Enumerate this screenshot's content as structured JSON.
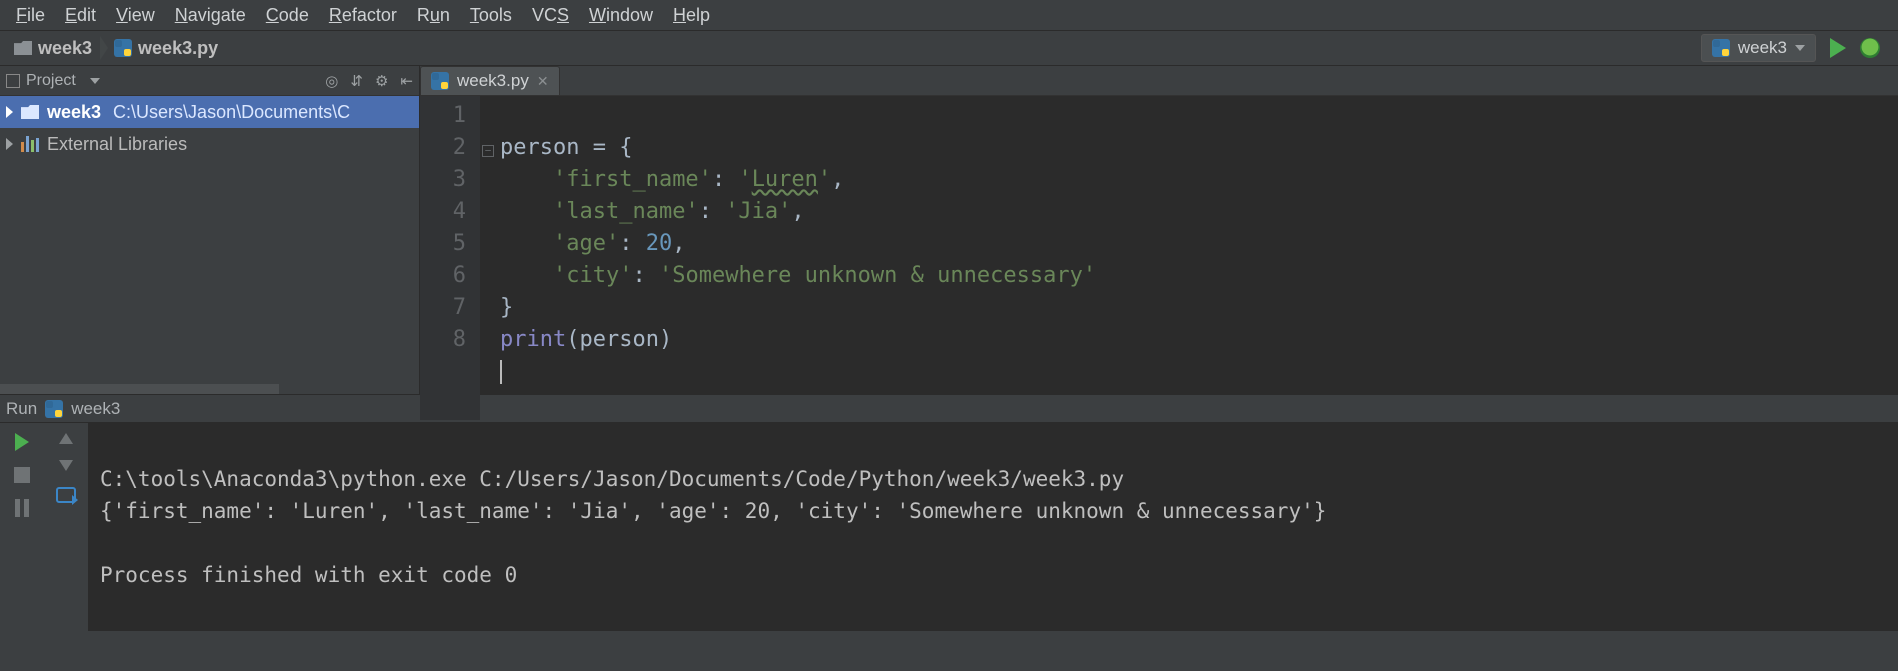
{
  "menu": {
    "items": [
      "File",
      "Edit",
      "View",
      "Navigate",
      "Code",
      "Refactor",
      "Run",
      "Tools",
      "VCS",
      "Window",
      "Help"
    ]
  },
  "breadcrumbs": {
    "project": "week3",
    "file": "week3.py"
  },
  "run_config": {
    "label": "week3"
  },
  "project_panel": {
    "title": "Project",
    "root_name": "week3",
    "root_path": "C:\\Users\\Jason\\Documents\\C",
    "ext_libs": "External Libraries"
  },
  "editor": {
    "tab": "week3.py",
    "gutter": [
      "1",
      "2",
      "3",
      "4",
      "5",
      "6",
      "7",
      "8"
    ],
    "code": {
      "l1_ident": "person",
      "l1_op": " = {",
      "l2_key": "'first_name'",
      "l2_val": "Luren",
      "l3_key": "'last_name'",
      "l3_val": "'Jia'",
      "l4_key": "'age'",
      "l4_val": "20",
      "l5_key": "'city'",
      "l5_val": "'Somewhere unknown & unnecessary'",
      "l6": "}",
      "l7_fn": "print",
      "l7_arg": "person"
    }
  },
  "run_panel": {
    "title": "Run",
    "config": "week3",
    "line1": "C:\\tools\\Anaconda3\\python.exe C:/Users/Jason/Documents/Code/Python/week3/week3.py",
    "line2": "{'first_name': 'Luren', 'last_name': 'Jia', 'age': 20, 'city': 'Somewhere unknown & unnecessary'}",
    "line3": "",
    "line4": "Process finished with exit code 0"
  }
}
